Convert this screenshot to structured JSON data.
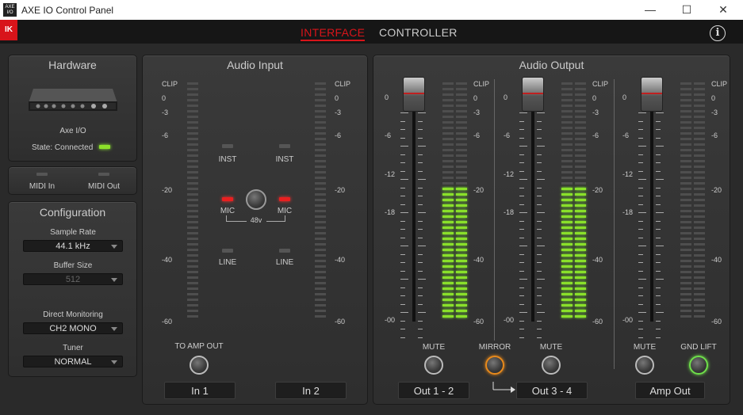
{
  "window": {
    "title": "AXE IO Control Panel",
    "icon_text": "AXE I/O",
    "minimize": "—",
    "maximize": "☐",
    "close": "✕"
  },
  "nav": {
    "logo": "IK",
    "tabs": [
      {
        "label": "INTERFACE",
        "active": true
      },
      {
        "label": "CONTROLLER",
        "active": false
      }
    ],
    "info": "i"
  },
  "hardware": {
    "title": "Hardware",
    "device": "Axe I/O",
    "status": "State: Connected"
  },
  "midi": {
    "in": "MIDI In",
    "out": "MIDI Out"
  },
  "configuration": {
    "title": "Configuration",
    "sample_rate_label": "Sample Rate",
    "sample_rate": "44.1 kHz",
    "buffer_label": "Buffer Size",
    "buffer": "512",
    "monitoring_label": "Direct Monitoring",
    "monitoring": "CH2 MONO",
    "tuner_label": "Tuner",
    "tuner": "NORMAL"
  },
  "input": {
    "title": "Audio Input",
    "scale": [
      "CLIP",
      "0",
      "-3",
      "-6",
      "-20",
      "-40",
      "-60"
    ],
    "inst": "INST",
    "mic": "MIC",
    "line": "LINE",
    "phantom": "48v",
    "to_amp": "TO AMP OUT",
    "ch1": "In 1",
    "ch2": "In 2"
  },
  "output": {
    "title": "Audio Output",
    "meter_scale": [
      "CLIP",
      "0",
      "-3",
      "-6",
      "-20",
      "-40",
      "-60"
    ],
    "fader_scale": [
      "0",
      "-6",
      "-12",
      "-18",
      "-00"
    ],
    "mute": "MUTE",
    "mirror": "MIRROR",
    "gnd": "GND LIFT",
    "out12": "Out 1 - 2",
    "out34": "Out 3 - 4",
    "amp": "Amp Out",
    "levels": {
      "out12": 0.56,
      "out34": 0.56,
      "amp": 0
    }
  }
}
